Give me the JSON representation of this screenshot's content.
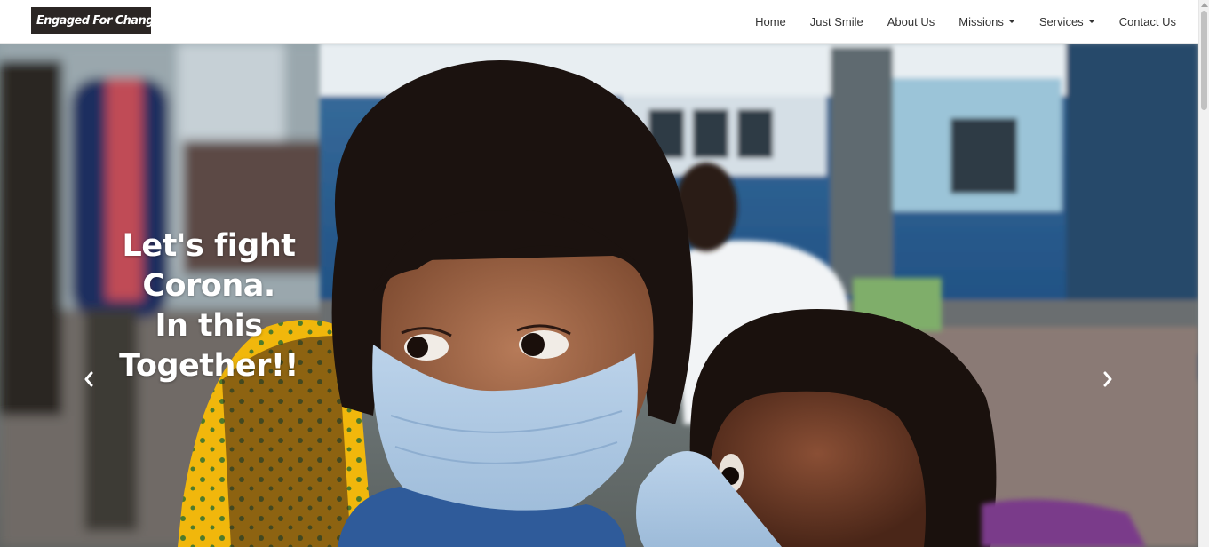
{
  "brand": {
    "name": "Engaged For Change"
  },
  "nav": {
    "items": [
      {
        "label": "Home"
      },
      {
        "label": "Just Smile"
      },
      {
        "label": "About Us"
      },
      {
        "label": "Missions",
        "dropdown": true
      },
      {
        "label": "Services",
        "dropdown": true
      },
      {
        "label": "Contact Us"
      }
    ]
  },
  "hero": {
    "caption_lines": [
      "Let's fight Corona.",
      "In this",
      "Together!!"
    ],
    "prev_icon": "chevron-left-icon",
    "next_icon": "chevron-right-icon"
  },
  "colors": {
    "brand_bg": "#2b2624",
    "brand_accent": "#f0b800",
    "nav_text": "#333333",
    "caption_text": "#ffffff"
  }
}
